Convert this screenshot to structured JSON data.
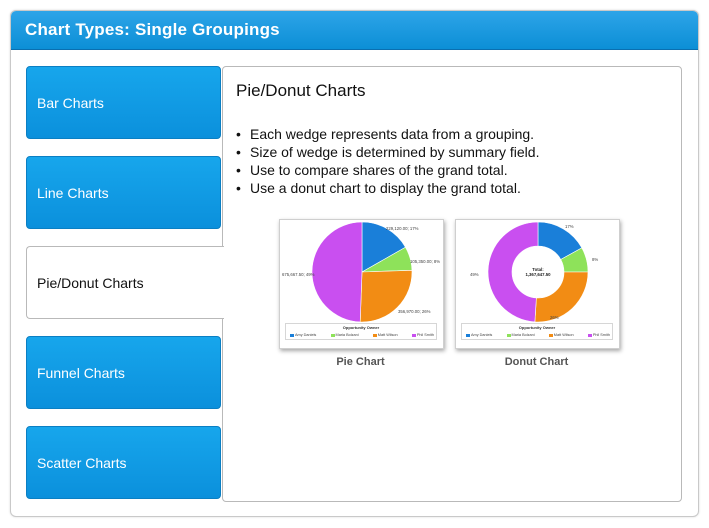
{
  "header": {
    "title": "Chart Types: Single Groupings"
  },
  "nav": {
    "tabs": [
      {
        "label": "Bar Charts",
        "active": false
      },
      {
        "label": "Line Charts",
        "active": false
      },
      {
        "label": "Pie/Donut Charts",
        "active": true
      },
      {
        "label": "Funnel Charts",
        "active": false
      },
      {
        "label": "Scatter Charts",
        "active": false
      }
    ]
  },
  "content": {
    "title": "Pie/Donut Charts",
    "bullets": [
      "Each wedge represents data from a grouping.",
      "Size of wedge is determined by summary field.",
      "Use to compare shares of the grand total.",
      "Use a donut chart to display the grand total."
    ]
  },
  "colors": {
    "accent": "#0c8fd6",
    "amy": "#1a7fd9",
    "maria": "#8ee25a",
    "matt": "#f28c14",
    "phil": "#c94ff0"
  },
  "chart_data": [
    {
      "type": "pie",
      "caption": "Pie Chart",
      "legend_title": "Opportunity Owner",
      "labels": [
        "Amy Daniels",
        "Maria Bolzani",
        "Matt Wilson",
        "Phil Smith"
      ],
      "values": [
        229120.0,
        105350.0,
        356970.0,
        675667.5
      ],
      "data_labels": [
        "229,120.00; 17%",
        "105,350.00; 8%",
        "356,970.00; 26%",
        "675,667.50; 49%"
      ]
    },
    {
      "type": "pie",
      "subtype": "donut",
      "caption": "Donut Chart",
      "legend_title": "Opportunity Owner",
      "labels": [
        "Amy Daniels",
        "Maria Bolzani",
        "Matt Wilson",
        "Phil Smith"
      ],
      "values": [
        17,
        8,
        26,
        49
      ],
      "data_labels": [
        "17%",
        "8%",
        "26%",
        "49%"
      ],
      "center_label": "Total:",
      "center_value": "1,367,647.50"
    }
  ]
}
